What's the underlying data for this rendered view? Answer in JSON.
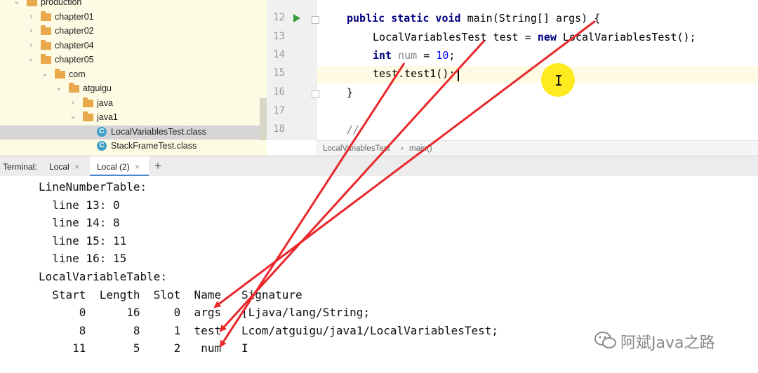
{
  "tree": {
    "items": [
      {
        "label": "production",
        "arrow": "⌄",
        "icon": "folder",
        "indent": 0
      },
      {
        "label": "chapter01",
        "arrow": "›",
        "icon": "folder",
        "indent": 1
      },
      {
        "label": "chapter02",
        "arrow": "›",
        "icon": "folder",
        "indent": 1
      },
      {
        "label": "chapter04",
        "arrow": "›",
        "icon": "folder",
        "indent": 1
      },
      {
        "label": "chapter05",
        "arrow": "⌄",
        "icon": "folder",
        "indent": 1
      },
      {
        "label": "com",
        "arrow": "⌄",
        "icon": "folder",
        "indent": 2
      },
      {
        "label": "atguigu",
        "arrow": "⌄",
        "icon": "folder",
        "indent": 3
      },
      {
        "label": "java",
        "arrow": "›",
        "icon": "folder",
        "indent": 4
      },
      {
        "label": "java1",
        "arrow": "⌄",
        "icon": "folder",
        "indent": 4
      },
      {
        "label": "LocalVariablesTest.class",
        "arrow": "",
        "icon": "class",
        "indent": 5,
        "selected": true
      },
      {
        "label": "StackFrameTest.class",
        "arrow": "",
        "icon": "class",
        "indent": 5
      }
    ]
  },
  "editor": {
    "line_numbers": [
      "12",
      "13",
      "14",
      "15",
      "16",
      "17",
      "18"
    ],
    "code": {
      "l12_kw": "public static void",
      "l12_rest": " main(String[] args) {",
      "l13_a": "LocalVariablesTest test = ",
      "l13_kw": "new",
      "l13_b": " LocalVariablesTest();",
      "l14_kw": "int",
      "l14_var": " num",
      "l14_eq": " = ",
      "l14_num": "10",
      "l14_end": ";",
      "l15": "test.test1();",
      "l16": "}",
      "l18": "//"
    },
    "breadcrumb": {
      "file": "LocalVariablesTest",
      "sep": "›",
      "method": "main()"
    },
    "cursor_char": "I"
  },
  "terminal": {
    "tabs_title": "Terminal:",
    "tabs": [
      {
        "label": "Local",
        "close": "×"
      },
      {
        "label": "Local (2)",
        "close": "×",
        "active": true
      }
    ],
    "add": "+",
    "lines": [
      "LineNumberTable:",
      "  line 13: 0",
      "  line 14: 8",
      "  line 15: 11",
      "  line 16: 15",
      "LocalVariableTable:",
      "  Start  Length  Slot  Name   Signature",
      "      0      16     0  args   [Ljava/lang/String;",
      "      8       8     1  test   Lcom/atguigu/java1/LocalVariablesTest;",
      "     11       5     2   num   I"
    ]
  },
  "annotations": {
    "arrow_color": "#e8282b"
  },
  "watermark": {
    "text": "阿斌Java之路",
    "icon": "wechat-icon"
  }
}
